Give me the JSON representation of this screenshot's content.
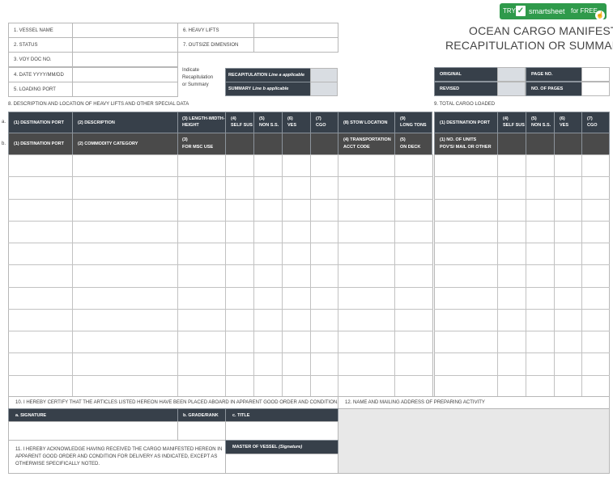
{
  "badge": {
    "try": "TRY",
    "brand": "smartsheet",
    "free": "for FREE"
  },
  "title": {
    "line1": "OCEAN CARGO MANIFEST",
    "line2": "RECAPITULATION OR SUMMARY"
  },
  "header_fields": {
    "vessel_name": "1. VESSEL NAME",
    "status": "2. STATUS",
    "voy_doc": "3. VOY DOC NO.",
    "date": "4. DATE  YYYY/MM/DD",
    "loading_port": "5. LOADING PORT",
    "heavy_lifts": "6. HEAVY LIFTS",
    "outsize": "7. OUTSIZE DIMENSION",
    "indicate_1": "Indicate",
    "indicate_2": "Recapitulation",
    "indicate_3": "or Summary",
    "recap_bold": "RECAPITULATION",
    "recap_italic": " Line a applicable",
    "summary_bold": "SUMMARY",
    "summary_italic": " Line b applicable",
    "original": "ORIGINAL",
    "revised": "REVISED",
    "page_no": "PAGE NO.",
    "no_pages": "NO. OF PAGES"
  },
  "section_labels": {
    "desc": "8. DESCRIPTION AND LOCATION OF HEAVY LIFTS AND OTHER SPECIAL DATA",
    "total": "9. TOTAL CARGO LOADED",
    "row_a": "a.",
    "row_b": "b."
  },
  "row_a": {
    "dest_port": "(1) DESTINATION PORT",
    "description": "(2) DESCRIPTION",
    "lwh_1": "(3) LENGTH-WIDTH-",
    "lwh_2": "HEIGHT",
    "c4_1": "(4)",
    "c4_2": "SELF SUS",
    "c5_1": "(5)",
    "c5_2": "NON S.S.",
    "c6_1": "(6)",
    "c6_2": "VES",
    "c7_1": "(7)",
    "c7_2": "CGO",
    "stow": "(8) STOW LOCATION",
    "c9_1": "(9)",
    "c9_2": "LONG TONS",
    "r_dest": "(1) DESTINATION PORT",
    "r4_1": "(4)",
    "r4_2": "SELF SUS",
    "r5_1": "(5)",
    "r5_2": "NON S.S.",
    "r6_1": "(6)",
    "r6_2": "VES",
    "r7_1": "(7)",
    "r7_2": "CGO"
  },
  "row_b": {
    "dest_port": "(1) DESTINATION PORT",
    "commodity": "(2) COMMODITY CATEGORY",
    "c3_1": "(3)",
    "c3_2": "FOR MSC USE",
    "trans_1": "(4) TRANSPORTATION",
    "trans_2": "ACCT CODE",
    "deck_1": "(5)",
    "deck_2": "ON DECK",
    "units_1": "(1) NO. OF UNITS",
    "units_2": "POV'S/ MAIL OR OTHER"
  },
  "footer": {
    "certify": "10. I HEREBY CERTIFY THAT THE ARTICLES LISTED HEREON HAVE BEEN PLACED ABOARD IN APPARENT GOOD ORDER AND CONDITION.",
    "mailing": "12. NAME AND MAILING ADDRESS OF PREPARING ACTIVITY",
    "signature": "a. SIGNATURE",
    "grade": "b. GRADE/RANK",
    "titlef": "c. TITLE",
    "ack_1": "11. I HEREBY ACKNOWLEDGE HAVING RECEIVED THE CARGO MANIFESTED HEREON IN",
    "ack_2": "APPARENT GOOD ORDER AND CONDITION FOR DELIVERY AS INDICATED, EXCEPT AS",
    "ack_3": "OTHERWISE SPECIFICALLY NOTED.",
    "master": "MASTER OF VESSEL",
    "master_sig": "(Signature)"
  }
}
